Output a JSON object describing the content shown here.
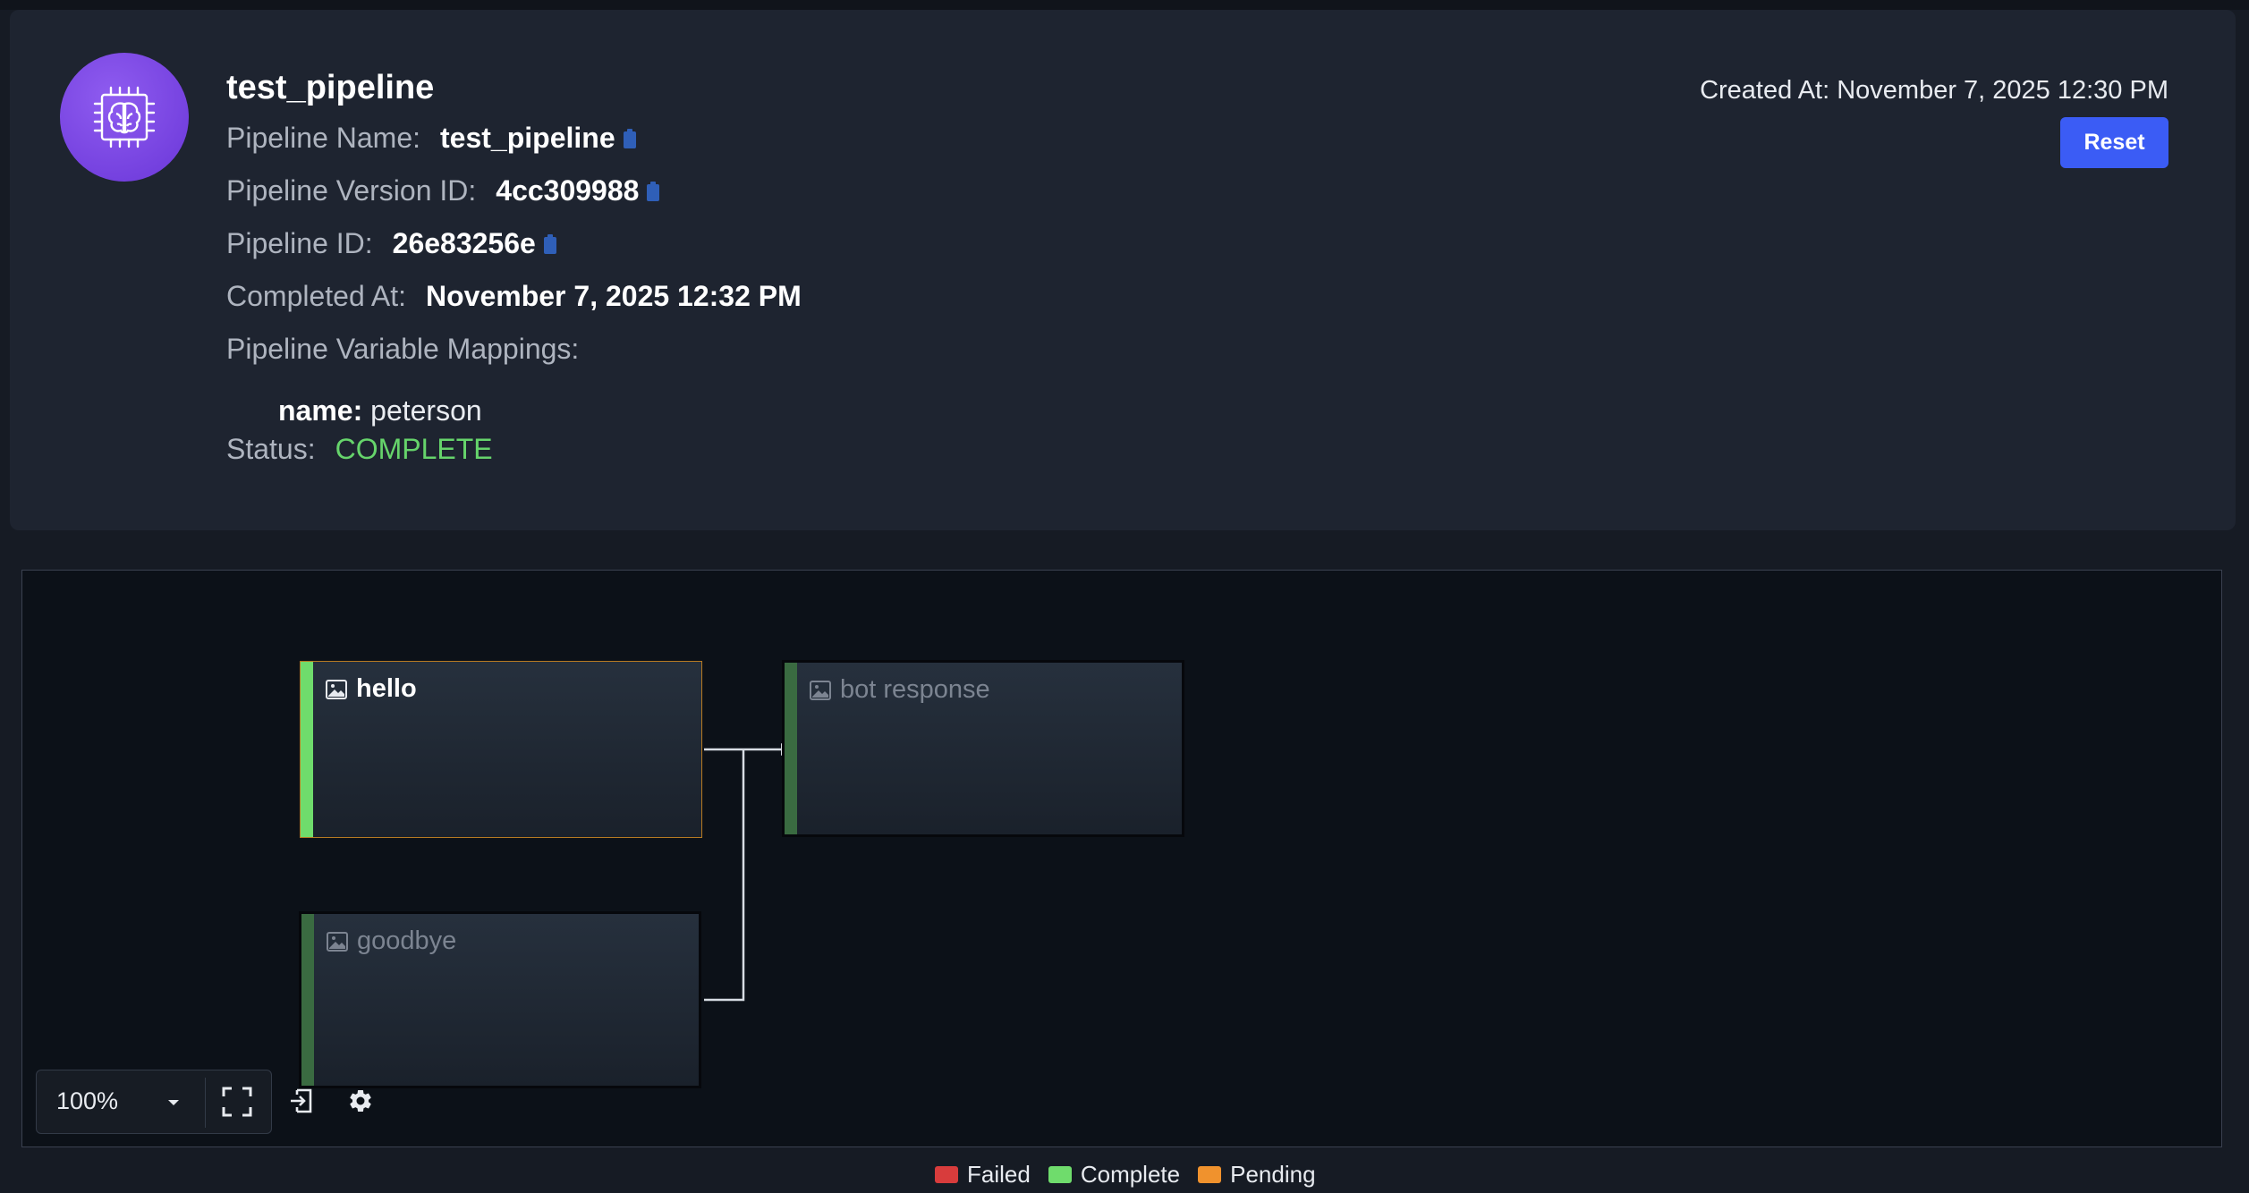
{
  "pipeline": {
    "title": "test_pipeline",
    "fields": [
      {
        "label": "Pipeline Name:",
        "value": "test_pipeline",
        "copyable": true
      },
      {
        "label": "Pipeline Version ID:",
        "value": "4cc309988",
        "copyable": true
      },
      {
        "label": "Pipeline ID:",
        "value": "26e83256e",
        "copyable": true
      },
      {
        "label": "Completed At:",
        "value": "November 7, 2025 12:32 PM",
        "copyable": false
      }
    ],
    "mappings_label": "Pipeline Variable Mappings:",
    "mappings": [
      {
        "key": "name:",
        "value": "peterson"
      }
    ],
    "status_label": "Status:",
    "status_value": "COMPLETE",
    "status_color": "#66d46b",
    "created_at": "Created At: November 7, 2025 12:30 PM",
    "reset_label": "Reset",
    "avatar_icon": "brain-chip-icon",
    "avatar_color": "#7c47e6"
  },
  "graph": {
    "nodes": [
      {
        "id": "hello",
        "label": "hello",
        "state": "active",
        "icon": "image-icon"
      },
      {
        "id": "bot_response",
        "label": "bot response",
        "state": "inactive",
        "icon": "image-icon"
      },
      {
        "id": "goodbye",
        "label": "goodbye",
        "state": "inactive",
        "icon": "image-icon"
      }
    ],
    "edges": [
      {
        "from": "hello",
        "to": "bot_response"
      },
      {
        "from": "goodbye",
        "to": "bot_response"
      }
    ]
  },
  "toolbar": {
    "zoom": "100%",
    "icons": [
      "chevron-down-icon",
      "fullscreen-icon",
      "export-icon",
      "gear-icon"
    ]
  },
  "legend": [
    {
      "label": "Failed",
      "color": "#d83c3c"
    },
    {
      "label": "Complete",
      "color": "#6fdc6c"
    },
    {
      "label": "Pending",
      "color": "#f0922d"
    }
  ]
}
